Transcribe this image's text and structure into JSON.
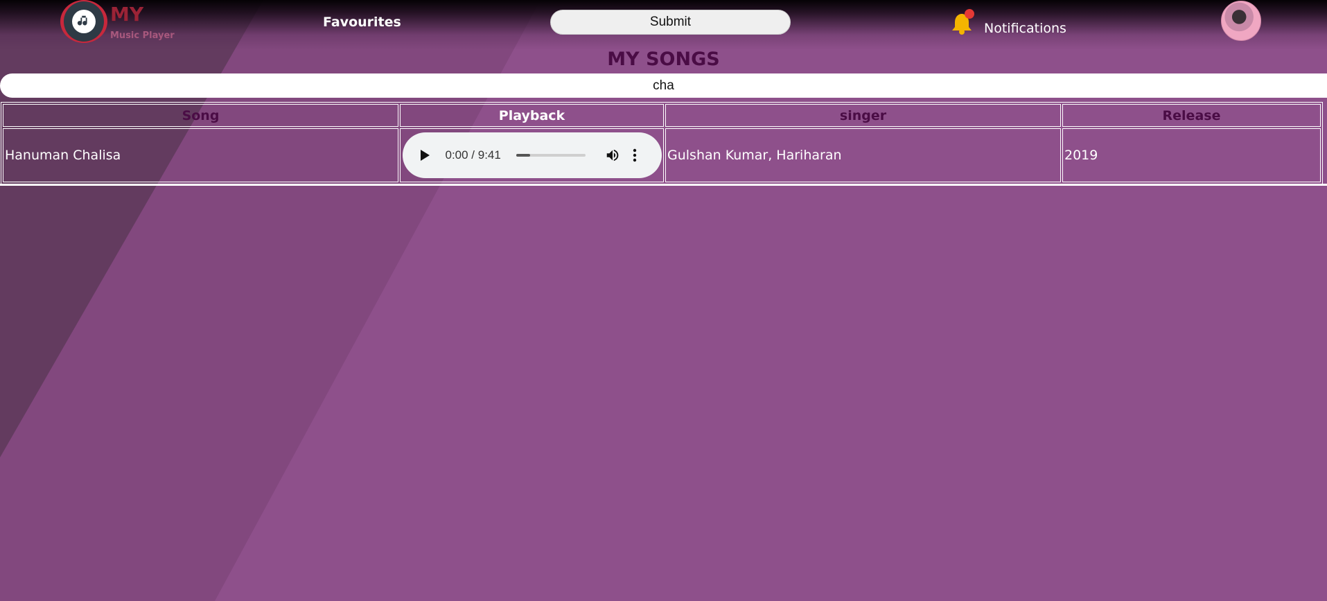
{
  "brand": {
    "title": "MY",
    "subtitle": "Music Player"
  },
  "nav": {
    "favourites": "Favourites",
    "submit": "Submit",
    "notifications": "Notifications"
  },
  "page": {
    "heading": "MY SONGS"
  },
  "search": {
    "value": "cha"
  },
  "table": {
    "headers": [
      "Song",
      "Playback",
      "singer",
      "Release"
    ],
    "rows": [
      {
        "song": "Hanuman Chalisa",
        "time": "0:00 / 9:41",
        "progress": 0.2,
        "singer": "Gulshan Kumar, Hariharan",
        "release": "2019"
      }
    ]
  },
  "colors": {
    "background": "#8e508b",
    "heading": "#4a0c45",
    "brand": "#9b2336",
    "bell": "#f4b400",
    "badge": "#e53935"
  },
  "icons": [
    "music-note-icon",
    "bell-icon",
    "play-icon",
    "volume-icon",
    "more-vert-icon"
  ]
}
